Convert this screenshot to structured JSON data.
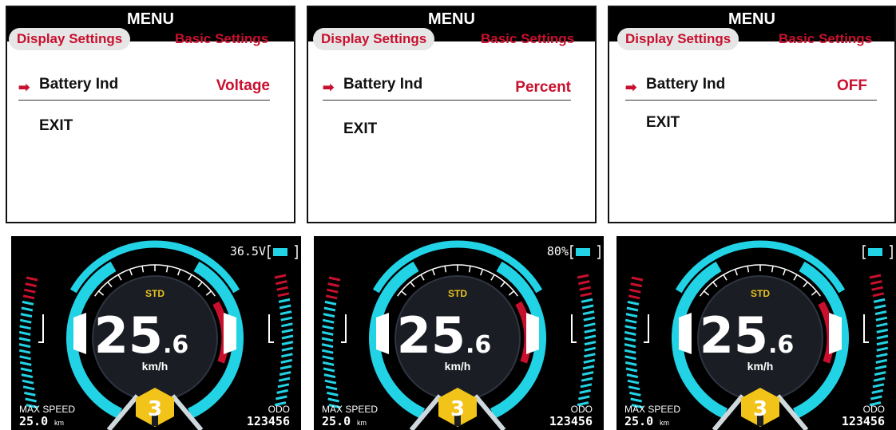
{
  "menu_panels": [
    {
      "title": "MENU",
      "tab_active": "Display Settings",
      "tab_other": "Basic Settings",
      "arrow": "➡",
      "item_label": "Battery Ind",
      "item_value": "Voltage",
      "exit_label": "EXIT"
    },
    {
      "title": "MENU",
      "tab_active": "Display Settings",
      "tab_other": "Basic Settings",
      "arrow": "➡",
      "item_label": "Battery Ind",
      "item_value": "Percent",
      "exit_label": "EXIT"
    },
    {
      "title": "MENU",
      "tab_active": "Display Settings",
      "tab_other": "Basic Settings",
      "arrow": "➡",
      "item_label": "Battery Ind",
      "item_value": "OFF",
      "exit_label": "EXIT"
    }
  ],
  "dash_panels": [
    {
      "battery_text": "36.5V",
      "mode": "STD",
      "speed_int": "25",
      "speed_dec": ".6",
      "speed_unit": "km/h",
      "max_label": "MAX SPEED",
      "max_value": "25.0",
      "max_unit": "km",
      "odo_label": "ODO",
      "odo_value": "123456",
      "gear": "3"
    },
    {
      "battery_text": "80%",
      "mode": "STD",
      "speed_int": "25",
      "speed_dec": ".6",
      "speed_unit": "km/h",
      "max_label": "MAX SPEED",
      "max_value": "25.0",
      "max_unit": "km",
      "odo_label": "ODO",
      "odo_value": "123456",
      "gear": "3"
    },
    {
      "battery_text": "",
      "mode": "STD",
      "speed_int": "25",
      "speed_dec": ".6",
      "speed_unit": "km/h",
      "max_label": "MAX SPEED",
      "max_value": "25.0",
      "max_unit": "km",
      "odo_label": "ODO",
      "odo_value": "123456",
      "gear": "3"
    }
  ],
  "colors": {
    "accent_red": "#c8102e",
    "cyan": "#22d3e6",
    "gear_yellow": "#f2c318",
    "panel_bg": "#000000"
  }
}
